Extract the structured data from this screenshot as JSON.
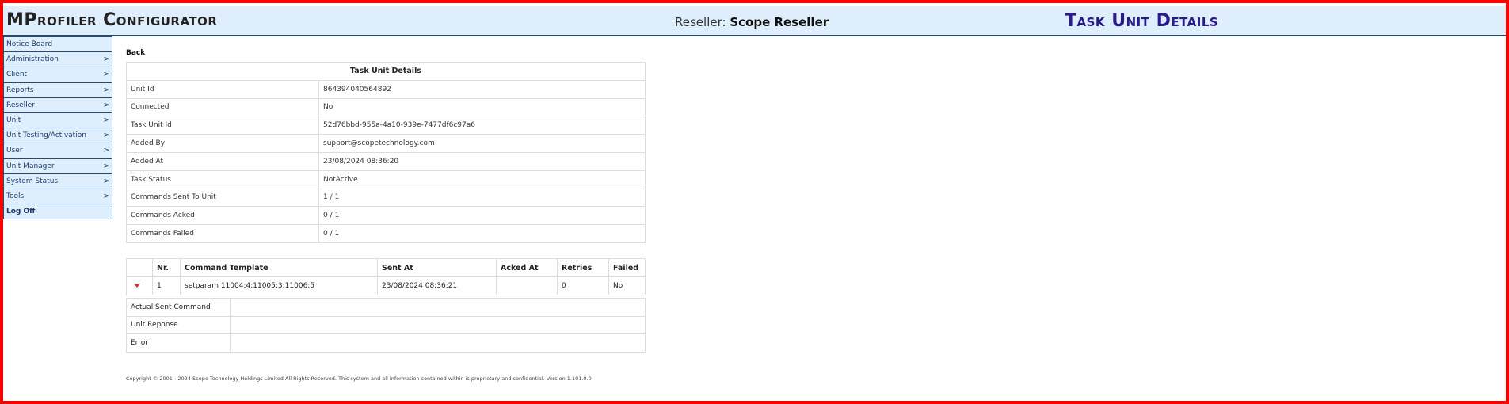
{
  "header": {
    "app_title": "MProfiler Configurator",
    "reseller_label": "Reseller:",
    "reseller_name": "Scope Reseller",
    "page_title": "Task Unit Details"
  },
  "sidebar": {
    "items": [
      {
        "label": "Notice Board",
        "arrow": ""
      },
      {
        "label": "Administration",
        "arrow": ">"
      },
      {
        "label": "Client",
        "arrow": ">"
      },
      {
        "label": "Reports",
        "arrow": ">"
      },
      {
        "label": "Reseller",
        "arrow": ">"
      },
      {
        "label": "Unit",
        "arrow": ">"
      },
      {
        "label": "Unit Testing/Activation",
        "arrow": ">"
      },
      {
        "label": "User",
        "arrow": ">"
      },
      {
        "label": "Unit Manager",
        "arrow": ">"
      },
      {
        "label": "System Status",
        "arrow": ">"
      },
      {
        "label": "Tools",
        "arrow": ">"
      },
      {
        "label": "Log Off",
        "arrow": ""
      }
    ]
  },
  "back_label": "Back",
  "details": {
    "heading": "Task Unit Details",
    "rows": [
      {
        "label": "Unit Id",
        "value": "864394040564892"
      },
      {
        "label": "Connected",
        "value": "No"
      },
      {
        "label": "Task Unit Id",
        "value": "52d76bbd-955a-4a10-939e-7477df6c97a6"
      },
      {
        "label": "Added By",
        "value": "support@scopetechnology.com"
      },
      {
        "label": "Added At",
        "value": "23/08/2024 08:36:20"
      },
      {
        "label": "Task Status",
        "value": "NotActive"
      },
      {
        "label": "Commands Sent To Unit",
        "value": "1 / 1"
      },
      {
        "label": "Commands Acked",
        "value": "0 / 1"
      },
      {
        "label": "Commands Failed",
        "value": "0 / 1"
      }
    ]
  },
  "commands": {
    "headers": [
      "",
      "Nr.",
      "Command Template",
      "Sent At",
      "Acked At",
      "Retries",
      "Failed"
    ],
    "row": {
      "nr": "1",
      "template": "setparam 11004:4;11005:3;11006:5",
      "sent_at": "23/08/2024 08:36:21",
      "acked_at": "",
      "retries": "0",
      "failed": "No"
    },
    "sub": [
      {
        "label": "Actual Sent Command",
        "value": ""
      },
      {
        "label": "Unit Reponse",
        "value": ""
      },
      {
        "label": "Error",
        "value": ""
      }
    ]
  },
  "footer": "Copyright © 2001 - 2024 Scope Technology Holdings Limited All Rights Reserved. This system and all information contained within is proprietary and confidential. Version 1.101.0.0"
}
